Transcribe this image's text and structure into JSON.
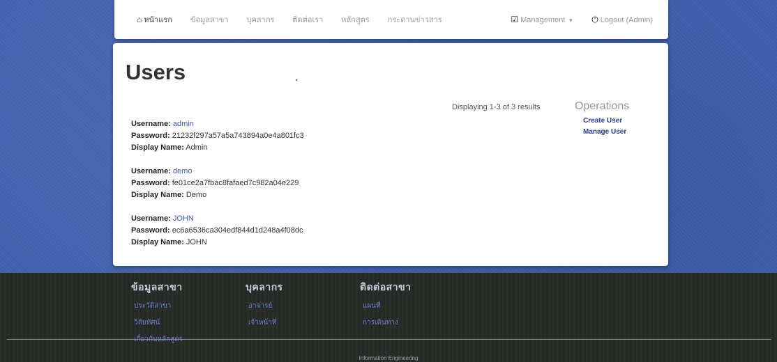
{
  "navbar": {
    "items": [
      {
        "label": "หน้าแรก"
      },
      {
        "label": "ข้อมูลสาขา"
      },
      {
        "label": "บุคลากร"
      },
      {
        "label": "ติดต่อเรา"
      },
      {
        "label": "หลักสูตร"
      },
      {
        "label": "กระดานข่าวสาร"
      }
    ],
    "management_label": "Management",
    "logout_label": "Logout (Admin)"
  },
  "main": {
    "title": "Users",
    "summary": "Displaying 1-3 of 3 results",
    "field_labels": {
      "username": "Username:",
      "password": "Password:",
      "display_name": "Display Name:"
    },
    "users": [
      {
        "username": "admin",
        "password": "21232f297a57a5a743894a0e4a801fc3",
        "display_name": "Admin"
      },
      {
        "username": "demo",
        "password": "fe01ce2a7fbac8fafaed7c982a04e229",
        "display_name": "Demo"
      },
      {
        "username": "JOHN",
        "password": "ec6a6536ca304edf844d1d248a4f08dc",
        "display_name": "JOHN"
      }
    ],
    "operations": {
      "title": "Operations",
      "links": [
        "Create User",
        "Manage User"
      ]
    }
  },
  "footer": {
    "columns": [
      {
        "heading": "ข้อมูลสาขา",
        "links": [
          "ประวัติสาขา",
          "วิสัยทัศน์",
          "เกี่ยวกับหลักสูตร"
        ]
      },
      {
        "heading": "บุคลากร",
        "links": [
          "อาจารย์",
          "เจ้าหน้าที่"
        ]
      },
      {
        "heading": "ติดต่อสาขา",
        "links": [
          "แผนที่",
          "การเดินทาง"
        ]
      }
    ],
    "copyright": "Information Engineering"
  },
  "colors": {
    "background": "#3f5fae",
    "link": "#3c5bb8",
    "operations_link": "#2a3b9a",
    "footer_bg": "#262b27"
  }
}
